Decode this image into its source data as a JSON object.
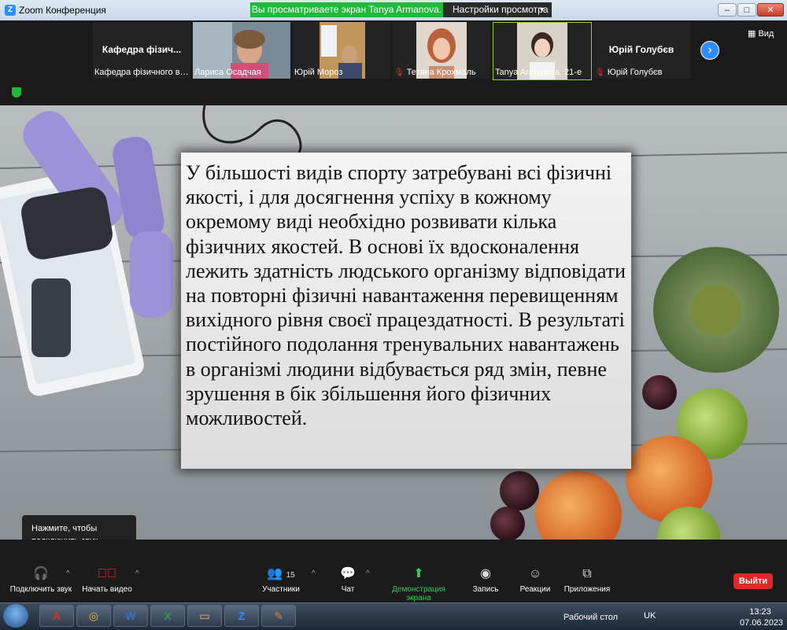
{
  "window": {
    "title": "Zoom Конференция",
    "share_banner": "Вы просматриваете экран Tanya Armanova. 21-е",
    "view_settings": "Настройки просмотра",
    "view_label": "Вид"
  },
  "gallery": {
    "tiles": [
      {
        "title": "Кафедра  фізич...",
        "name": "Кафедра фізичного вих..."
      },
      {
        "name": "Лариса Осадчая"
      },
      {
        "name": "Юрій Мороз"
      },
      {
        "name": "Тетяна Крохмаль",
        "muted": true
      },
      {
        "name": "Tanya Armanova. 21-е"
      },
      {
        "title": "Юрій Голубєв",
        "name": "Юрій Голубєв",
        "muted": true
      }
    ]
  },
  "slide": {
    "text": "У більшості видів спорту затребувані всі фізичні якості, і для досягнення успіху в кожному окремому виді необхідно розвивати кілька фізичних якостей. В основі їх вдосконалення лежить здатність людського організму відповідати на повторні фізичні навантаження перевищенням вихідного рівня своєї працездатності. В результаті постійного подолання тренувальних навантажень в організмі людини відбувається ряд змін, певне зрушення в бік збільшення його фізичних можливостей."
  },
  "tooltip": {
    "line1": "Нажмите, чтобы",
    "line2": "подключить звук"
  },
  "toolbar": {
    "audio": "Подключить звук",
    "video": "Начать видео",
    "participants": "Участники",
    "participants_count": "15",
    "chat": "Чат",
    "share": "Демонстрация экрана",
    "record": "Запись",
    "reactions": "Реакции",
    "apps": "Приложения",
    "leave": "Выйти"
  },
  "taskbar": {
    "desktop": "Рабочий стол",
    "lang": "UK",
    "time": "13:23",
    "date": "07.06.2023"
  },
  "colors": {
    "zoom_blue": "#2d8cff",
    "share_green": "#1fba3a",
    "leave_red": "#e02828"
  }
}
